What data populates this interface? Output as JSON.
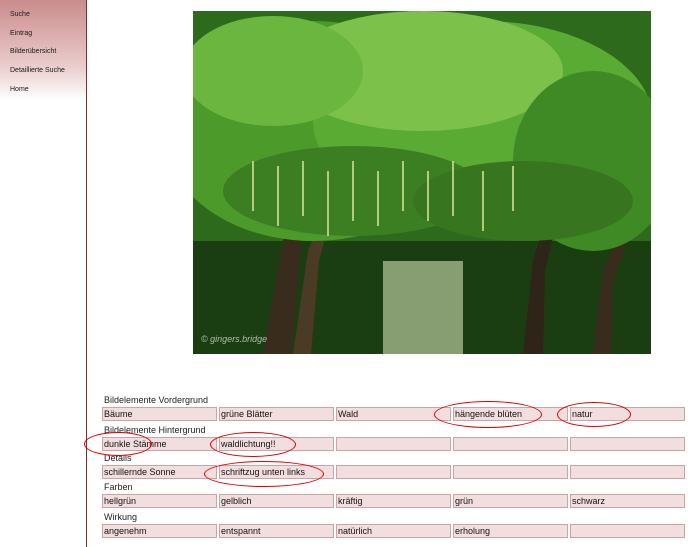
{
  "nav": {
    "items": [
      "Suche",
      "Eintrag",
      "Bilderübersicht",
      "Detaillierte Suche",
      "Home"
    ]
  },
  "photo": {
    "watermark": "© gingers.bridge"
  },
  "form": {
    "sections": [
      {
        "label": "Bildelemente Vordergrund",
        "cells": [
          "Bäume",
          "grüne Blätter",
          "Wald",
          "hängende blüten",
          "natur"
        ]
      },
      {
        "label": "Bildelemente Hintergrund",
        "cells": [
          "dunkle Stämme",
          "waldlichtung!!",
          "",
          "",
          ""
        ]
      },
      {
        "label": "Details",
        "cells": [
          "schillernde Sonne",
          "schriftzug unten links",
          "",
          "",
          ""
        ]
      },
      {
        "label": "Farben",
        "cells": [
          "hellgrün",
          "gelblich",
          "kräftig",
          "grün",
          "schwarz"
        ]
      },
      {
        "label": "Wirkung",
        "cells": [
          "angenehm",
          "entspannt",
          "natürlich",
          "erholung",
          ""
        ]
      }
    ]
  },
  "colors": {
    "annotation": "#e00000",
    "cell_background": "#f2dede",
    "cell_border": "#c9a5a5",
    "sidebar_accent": "#7a2f2f"
  }
}
